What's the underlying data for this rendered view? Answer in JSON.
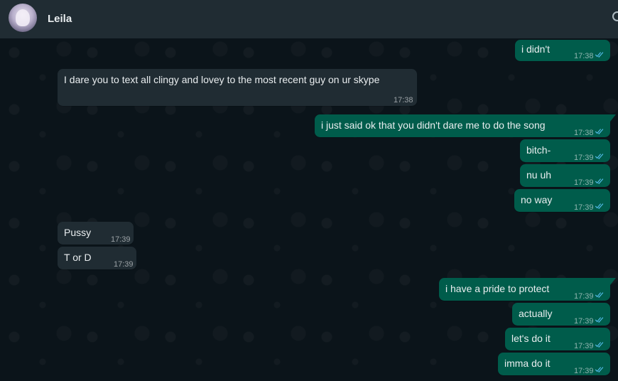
{
  "header": {
    "contact_name": "Leila"
  },
  "messages": [
    {
      "dir": "out",
      "text": "i didn't",
      "time": "17:38",
      "status": "read"
    },
    {
      "dir": "in",
      "text": "I dare you to text all clingy and lovey to the most recent guy on ur skype",
      "time": "17:38"
    },
    {
      "dir": "out",
      "text": "i just said ok that you didn't dare me to do the song",
      "time": "17:38",
      "status": "read"
    },
    {
      "dir": "out",
      "text": "bitch-",
      "time": "17:39",
      "status": "read"
    },
    {
      "dir": "out",
      "text": "nu uh",
      "time": "17:39",
      "status": "read"
    },
    {
      "dir": "out",
      "text": "no way",
      "time": "17:39",
      "status": "read"
    },
    {
      "dir": "in",
      "text": "Pussy",
      "time": "17:39"
    },
    {
      "dir": "in",
      "text": "T or D",
      "time": "17:39"
    },
    {
      "dir": "out",
      "text": "i have a pride to protect",
      "time": "17:39",
      "status": "read"
    },
    {
      "dir": "out",
      "text": "actually",
      "time": "17:39",
      "status": "read"
    },
    {
      "dir": "out",
      "text": "let's do it",
      "time": "17:39",
      "status": "read"
    },
    {
      "dir": "out",
      "text": "imma do it",
      "time": "17:39",
      "status": "read"
    }
  ],
  "colors": {
    "outgoing_bubble": "#005c4b",
    "incoming_bubble": "#202c33",
    "read_ticks": "#53bdeb",
    "header_bg": "#202c33",
    "chat_bg": "#0b141a"
  },
  "icons": {
    "read_status": "double-check-icon",
    "header_right": "search-icon"
  }
}
